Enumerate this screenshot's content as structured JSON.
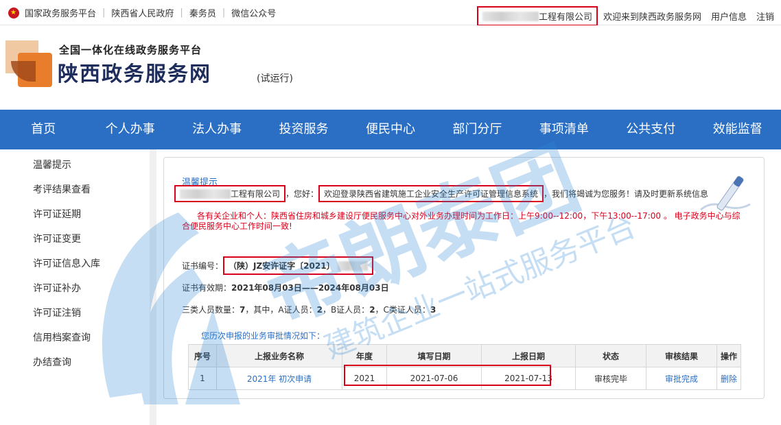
{
  "topbar": {
    "links": [
      "国家政务服务平台",
      "陕西省人民政府",
      "秦务员",
      "微信公众号"
    ],
    "company_suffix": "工程有限公司",
    "welcome": "欢迎来到陕西政务服务网",
    "user_info": "用户信息",
    "logout": "注销"
  },
  "header": {
    "sub_title": "全国一体化在线政务服务平台",
    "main_title": "陕西政务服务网",
    "trial": "(试运行)"
  },
  "nav": {
    "items": [
      "首页",
      "个人办事",
      "法人办事",
      "投资服务",
      "便民中心",
      "部门分厅",
      "事项清单",
      "公共支付",
      "效能监督"
    ]
  },
  "sidebar": {
    "items": [
      "温馨提示",
      "考评结果查看",
      "许可证延期",
      "许可证变更",
      "许可证信息入库",
      "许可证补办",
      "许可证注销",
      "信用档案查询",
      "办结查询"
    ]
  },
  "main": {
    "title": "温馨提示",
    "company_suffix": "工程有限公司",
    "greeting_tail": "，您好：",
    "system_welcome": "欢迎登录陕西省建筑施工企业安全生产许可证管理信息系统",
    "greeting_end": "，我们将竭诚为您服务！请及时更新系统信息",
    "notice": "各有关企业和个人：陕西省住房和城乡建设厅便民服务中心对外业务办理时间为工作日：上午9:00--12:00，下午13:00--17:00 。 电子政务中心与综合便民服务中心工作时间一致!",
    "cert_label": "证书编号：",
    "cert_value": "（陕）JZ安许证字〔2021〕",
    "validity_label": "证书有效期：",
    "validity_value": "2021年08月03日——2024年08月03日",
    "counts_label": "三类人员数量：",
    "counts_total": "7",
    "counts_mid": "，其中，A证人员：",
    "counts_a": "2",
    "counts_b_label": "，B证人员：",
    "counts_b": "2",
    "counts_c_label": "，C类证人员：",
    "counts_c": "3",
    "history_title": "您历次申报的业务审批情况如下："
  },
  "table": {
    "headers": [
      "序号",
      "上报业务名称",
      "年度",
      "填写日期",
      "上报日期",
      "状态",
      "审核结果",
      "操作"
    ],
    "rows": [
      {
        "no": "1",
        "name": "2021年 初次申请",
        "year": "2021",
        "fill_date": "2021-07-06",
        "report_date": "2021-07-13",
        "status": "审核完毕",
        "result": "审批完成",
        "action": "删除"
      }
    ]
  },
  "watermark": {
    "brand": "帝朗泰团",
    "slogan": "建筑企业一站式服务平台"
  },
  "colors": {
    "nav_blue": "#2a6fc4",
    "link_blue": "#2a6fc4",
    "highlight_red": "#d9001b"
  }
}
